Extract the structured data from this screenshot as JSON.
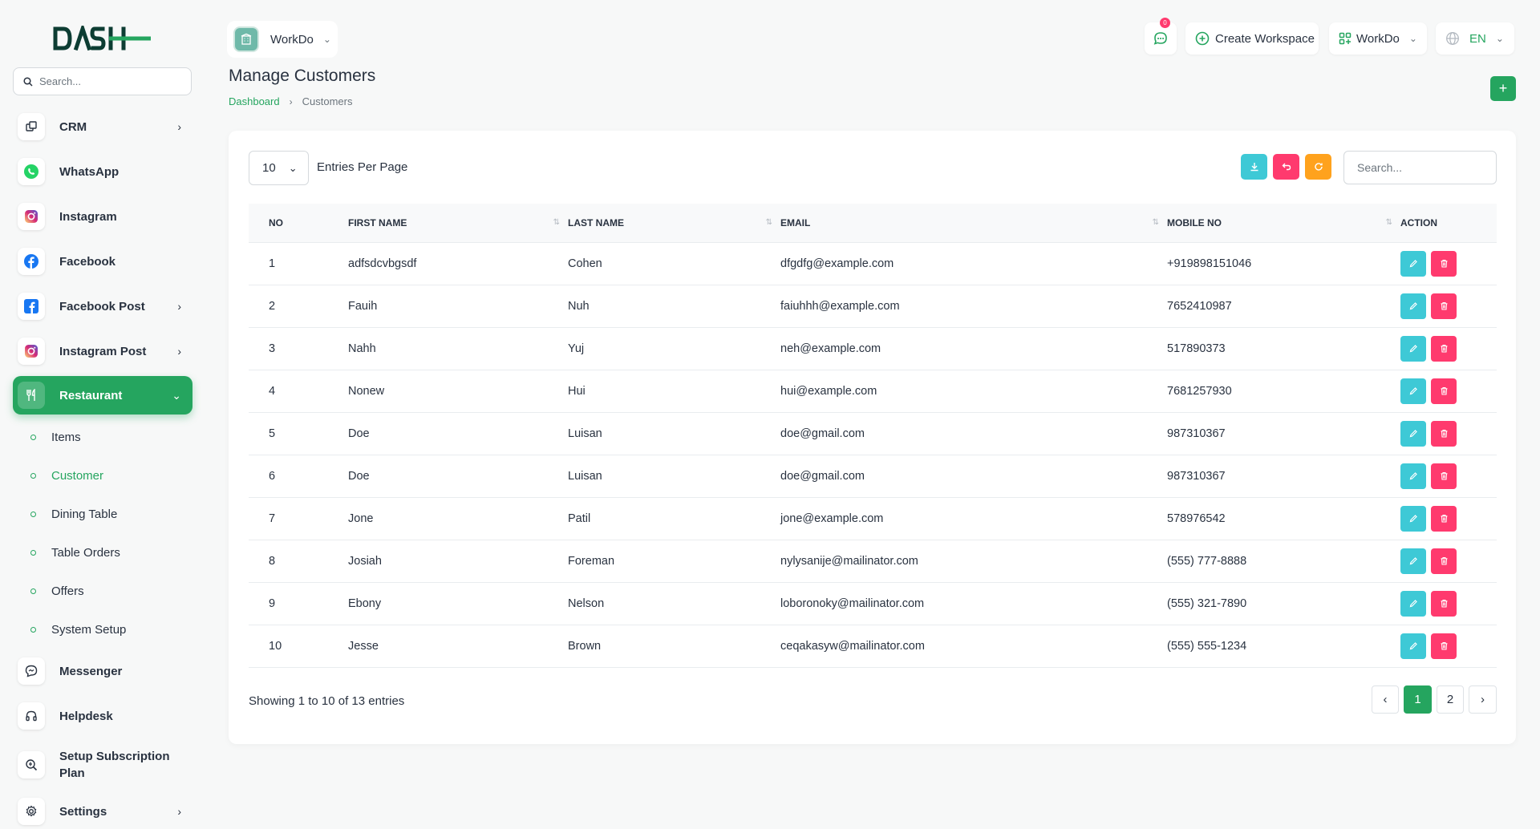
{
  "brand": {
    "logo_text": "DASH"
  },
  "sidebar": {
    "search_placeholder": "Search...",
    "items": [
      {
        "label": "CRM",
        "icon": "layers-icon",
        "chevron": true
      },
      {
        "label": "WhatsApp",
        "icon": "whatsapp-icon",
        "chevron": false
      },
      {
        "label": "Instagram",
        "icon": "instagram-icon",
        "chevron": false
      },
      {
        "label": "Facebook",
        "icon": "facebook-icon",
        "chevron": false
      },
      {
        "label": "Facebook Post",
        "icon": "facebook-post-icon",
        "chevron": true
      },
      {
        "label": "Instagram Post",
        "icon": "instagram-post-icon",
        "chevron": true
      },
      {
        "label": "Restaurant",
        "icon": "restaurant-icon",
        "chevron": true,
        "active": true
      }
    ],
    "restaurant_sub": [
      "Items",
      "Customer",
      "Dining Table",
      "Table Orders",
      "Offers",
      "System Setup"
    ],
    "active_sub": "Customer",
    "bottom_items": [
      {
        "label": "Messenger",
        "icon": "messenger-icon"
      },
      {
        "label": "Helpdesk",
        "icon": "headset-icon"
      },
      {
        "label": "Setup Subscription Plan",
        "icon": "subscription-icon"
      },
      {
        "label": "Settings",
        "icon": "gear-icon",
        "chevron": true
      }
    ]
  },
  "header": {
    "workspace_selector": "WorkDo",
    "notification_count": "0",
    "create_workspace": "Create Workspace",
    "workspace_menu": "WorkDo",
    "language": "EN"
  },
  "page": {
    "title": "Manage Customers",
    "breadcrumb": {
      "home": "Dashboard",
      "current": "Customers"
    }
  },
  "table_controls": {
    "per_page_value": "10",
    "per_page_label": "Entries Per Page",
    "search_placeholder": "Search..."
  },
  "colors": {
    "accent": "#25a55f",
    "edit": "#3ec9d6",
    "delete": "#ff3a6e",
    "export": "#3ec9d6",
    "refresh": "#ffa21d"
  },
  "table": {
    "headers": [
      "NO",
      "FIRST NAME",
      "LAST NAME",
      "EMAIL",
      "MOBILE NO",
      "ACTION"
    ],
    "rows": [
      [
        "1",
        "adfsdcvbgsdf",
        "Cohen",
        "dfgdfg@example.com",
        "+919898151046"
      ],
      [
        "2",
        "Fauih",
        "Nuh",
        "faiuhhh@example.com",
        "7652410987"
      ],
      [
        "3",
        "Nahh",
        "Yuj",
        "neh@example.com",
        "517890373"
      ],
      [
        "4",
        "Nonew",
        "Hui",
        "hui@example.com",
        "7681257930"
      ],
      [
        "5",
        "Doe",
        "Luisan",
        "doe@gmail.com",
        "987310367"
      ],
      [
        "6",
        "Doe",
        "Luisan",
        "doe@gmail.com",
        "987310367"
      ],
      [
        "7",
        "Jone",
        "Patil",
        "jone@example.com",
        "578976542"
      ],
      [
        "8",
        "Josiah",
        "Foreman",
        "nylysanije@mailinator.com",
        "(555) 777-8888"
      ],
      [
        "9",
        "Ebony",
        "Nelson",
        "loboronoky@mailinator.com",
        "(555) 321-7890"
      ],
      [
        "10",
        "Jesse",
        "Brown",
        "ceqakasyw@mailinator.com",
        "(555) 555-1234"
      ]
    ]
  },
  "footer": {
    "showing": "Showing 1 to 10 of 13 entries",
    "pages": [
      "1",
      "2"
    ],
    "current_page": "1",
    "prev": "‹",
    "next": "›"
  }
}
